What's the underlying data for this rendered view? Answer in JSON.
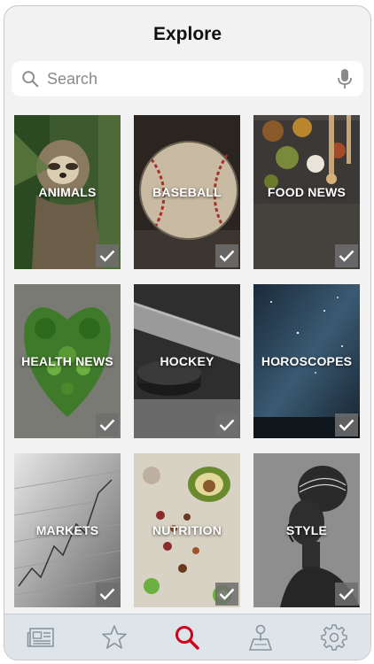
{
  "header": {
    "title": "Explore"
  },
  "search": {
    "placeholder": "Search"
  },
  "tiles": [
    {
      "label": "ANIMALS"
    },
    {
      "label": "BASEBALL"
    },
    {
      "label": "FOOD NEWS"
    },
    {
      "label": "HEALTH NEWS"
    },
    {
      "label": "HOCKEY"
    },
    {
      "label": "HOROSCOPES"
    },
    {
      "label": "MARKETS"
    },
    {
      "label": "NUTRITION"
    },
    {
      "label": "STYLE"
    }
  ],
  "tabbar": {
    "items": [
      {
        "icon": "news-icon"
      },
      {
        "icon": "star-icon"
      },
      {
        "icon": "search-icon",
        "active": true
      },
      {
        "icon": "local-icon"
      },
      {
        "icon": "gear-icon"
      }
    ],
    "active_color": "#d0021b",
    "inactive_color": "#8a949c"
  }
}
